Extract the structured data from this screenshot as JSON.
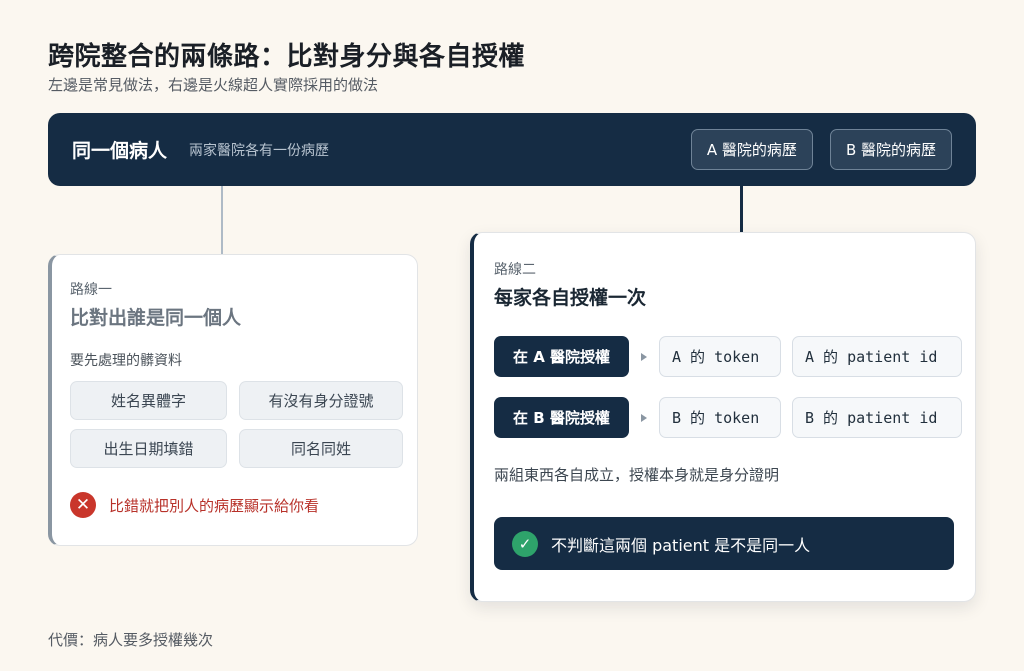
{
  "header": {
    "title": "跨院整合的兩條路：比對身分與各自授權",
    "subtitle": "左邊是常見做法，右邊是火線超人實際採用的做法"
  },
  "topbar": {
    "patient": "同一個病人",
    "description": "兩家醫院各有一份病歷",
    "records": [
      "A 醫院的病歷",
      "B 醫院的病歷"
    ]
  },
  "route1": {
    "label": "路線一",
    "title": "比對出誰是同一個人",
    "needs": "要先處理的髒資料",
    "issues": [
      "姓名異體字",
      "有沒有身分證號",
      "出生日期填錯",
      "同名同姓"
    ],
    "warning_icon": "x-icon",
    "warning": "比錯就把別人的病歷顯示給你看"
  },
  "route2": {
    "label": "路線二",
    "title": "每家各自授權一次",
    "rows": [
      {
        "auth": "在 A 醫院授權",
        "token": "A 的 token",
        "pid": "A 的 patient id"
      },
      {
        "auth": "在 B 醫院授權",
        "token": "B 的 token",
        "pid": "B 的 patient id"
      }
    ],
    "note": "兩組東西各自成立，授權本身就是身分證明",
    "ok_icon": "check-icon",
    "ok": "不判斷這兩個 patient 是不是同一人"
  },
  "footer": "代價：病人要多授權幾次",
  "colors": {
    "navy": "#152c44",
    "danger": "#c9362b",
    "success": "#2ea36b",
    "background": "#fbf7f0"
  }
}
